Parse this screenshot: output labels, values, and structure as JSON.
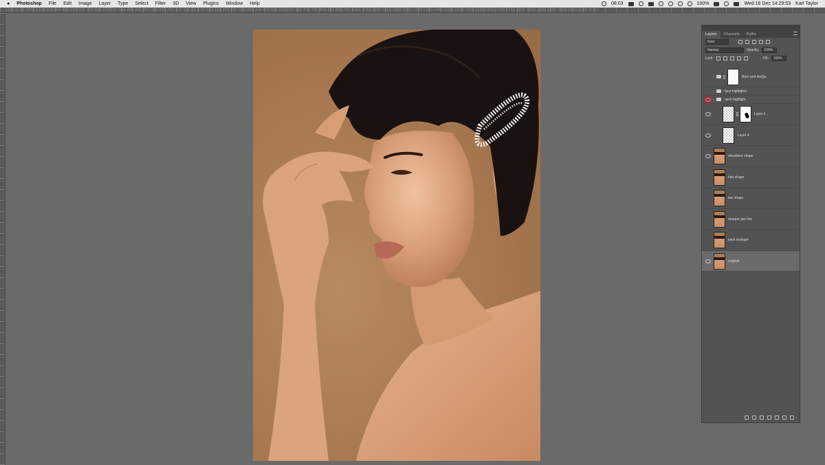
{
  "menubar": {
    "app_name": "Photoshop",
    "items": [
      "File",
      "Edit",
      "Image",
      "Layer",
      "Type",
      "Select",
      "Filter",
      "3D",
      "View",
      "Plugins",
      "Window",
      "Help"
    ],
    "time_short": "08:03",
    "battery": "100%",
    "date_time": "Wed 16 Dec  14:29:53",
    "user": "Karl Taylor"
  },
  "ruler_top": {
    "labels": "1150 1100 1050 1000 950 900 850 800 750 700 650 600 550 500 450 400 350 300 250 200 150 100 50 0 50 100 150 200 250 300 350 400 450 500 550 600 650 700 750 800 850 900 950 1000 1050 1100 1150 1200 1250 1300 1350 1400 1450 1500 1550 1600 1650 1700 1750 1800 1850 1900 1950 2000 2050 2100 2150"
  },
  "panel": {
    "tabs": [
      "Layers",
      "Channels",
      "Paths"
    ],
    "filter_kind": "Kind",
    "blend_mode": "Normal",
    "opacity_label": "Opacity:",
    "opacity_value": "100%",
    "lock_label": "Lock:",
    "fill_label": "Fill:",
    "fill_value": "100%"
  },
  "layers": [
    {
      "name": "Burn and dodge",
      "type": "group-smart",
      "visible": false
    },
    {
      "name": "face highlights",
      "type": "group",
      "visible": false
    },
    {
      "name": "neck highlight",
      "type": "group",
      "visible": true
    },
    {
      "name": "Layer 6",
      "type": "masked",
      "visible": true
    },
    {
      "name": "Layer 4",
      "type": "transparent",
      "visible": true
    },
    {
      "name": "shoulders shape",
      "type": "photo",
      "visible": true
    },
    {
      "name": "hair shape",
      "type": "photo",
      "visible": false
    },
    {
      "name": "ear shape",
      "type": "photo",
      "visible": false
    },
    {
      "name": "sharper jaw line",
      "type": "photo",
      "visible": false
    },
    {
      "name": "wrist reshape",
      "type": "photo",
      "visible": false
    },
    {
      "name": "original",
      "type": "photo",
      "visible": true
    }
  ],
  "colors": {
    "workspace": "#6a6a6a",
    "panel": "#535353",
    "backdrop": "#a97a52",
    "skin": "#d9a07a",
    "hair": "#1a1210",
    "highlight_eye": "#c0222a"
  }
}
